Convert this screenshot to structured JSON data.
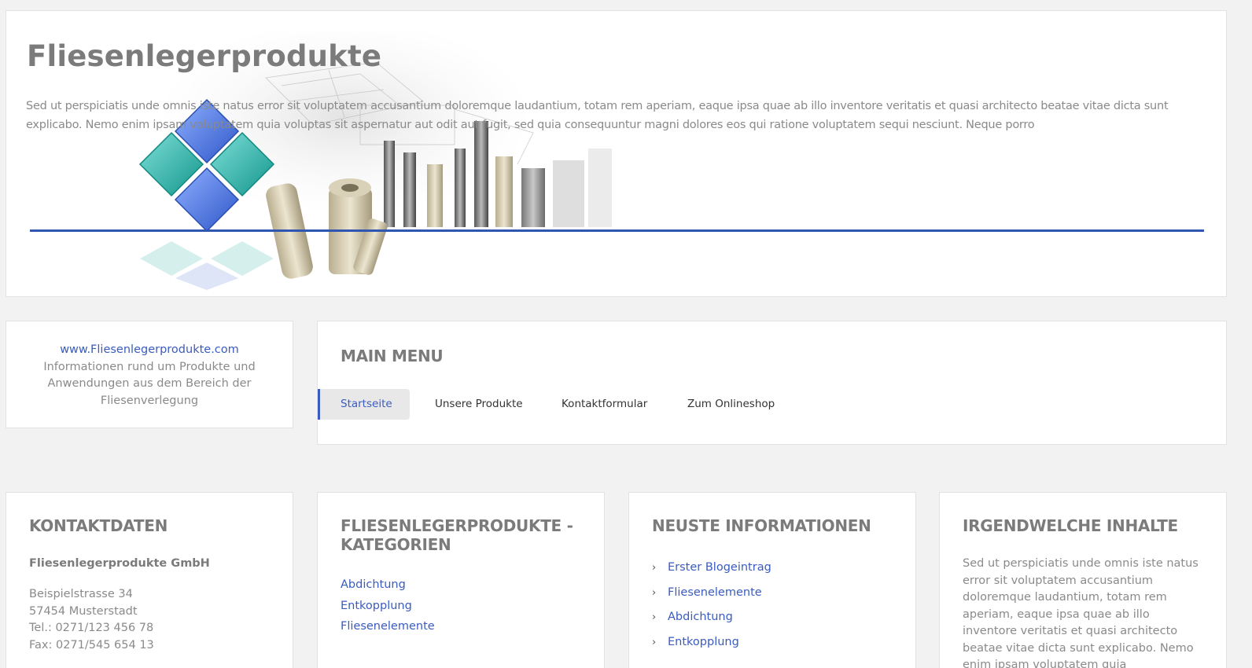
{
  "header": {
    "title": "Fliesenlegerprodukte",
    "intro": "Sed ut perspiciatis unde omnis iste natus error sit voluptatem accusantium doloremque laudantium, totam rem aperiam, eaque ipsa quae ab illo inventore veritatis et quasi architecto beatae vitae dicta sunt explicabo. Nemo enim ipsam voluptatem quia voluptas sit aspernatur aut odit aut fugit, sed quia consequuntur magni dolores eos qui ratione voluptatem sequi nesciunt. Neque porro",
    "accent_color": "#2f56b0",
    "diamond_colors": [
      "#4a73d8",
      "#1fa9a0"
    ]
  },
  "info": {
    "url": "www.Fliesenlegerprodukte.com",
    "text": "Informationen rund um Produkte und Anwendungen aus dem Bereich der Fliesenverlegung"
  },
  "menu": {
    "heading": "MAIN MENU",
    "items": [
      {
        "label": "Startseite",
        "active": true
      },
      {
        "label": "Unsere Produkte"
      },
      {
        "label": "Kontaktformular"
      },
      {
        "label": "Zum Onlineshop"
      }
    ]
  },
  "contact": {
    "heading": "KONTAKTDATEN",
    "company": "Fliesenlegerprodukte GmbH",
    "street": "Beispielstrasse 34",
    "city": "57454 Musterstadt",
    "tel": "Tel.: 0271/123 456 78",
    "fax": "Fax: 0271/545 654 13"
  },
  "categories": {
    "heading": "FLIESENLEGERPRODUKTE - KATEGORIEN",
    "items": [
      "Abdichtung",
      "Entkopplung",
      "Fliesenelemente"
    ]
  },
  "news": {
    "heading": "NEUSTE INFORMATIONEN",
    "items": [
      "Erster Blogeintrag",
      "Fliesenelemente",
      "Abdichtung",
      "Entkopplung"
    ]
  },
  "misc": {
    "heading": "IRGENDWELCHE INHALTE",
    "text": "Sed ut perspiciatis unde omnis iste natus error sit voluptatem accusantium doloremque laudantium, totam rem aperiam, eaque ipsa quae ab illo inventore veritatis et quasi architecto beatae vitae dicta sunt explicabo. Nemo enim ipsam voluptatem quia"
  }
}
